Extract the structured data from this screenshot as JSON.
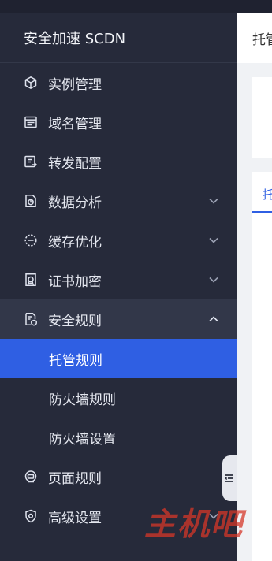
{
  "app": {
    "title": "安全加速 SCDN"
  },
  "sidebar": {
    "items": [
      {
        "label": "实例管理",
        "icon": "cube-icon"
      },
      {
        "label": "域名管理",
        "icon": "domain-window-icon"
      },
      {
        "label": "转发配置",
        "icon": "forward-config-icon"
      },
      {
        "label": "数据分析",
        "icon": "data-chart-icon",
        "expandable": true,
        "expanded": false
      },
      {
        "label": "缓存优化",
        "icon": "cache-icon",
        "expandable": true,
        "expanded": false
      },
      {
        "label": "证书加密",
        "icon": "certificate-icon",
        "expandable": true,
        "expanded": false
      },
      {
        "label": "安全规则",
        "icon": "security-doc-icon",
        "expandable": true,
        "expanded": true,
        "children": [
          {
            "label": "托管规则",
            "active": true
          },
          {
            "label": "防火墙规则"
          },
          {
            "label": "防火墙设置"
          }
        ]
      },
      {
        "label": "页面规则",
        "icon": "page-rule-icon"
      },
      {
        "label": "高级设置",
        "icon": "shield-settings-icon",
        "expandable": true,
        "expanded": false
      }
    ]
  },
  "content": {
    "header_title": "托管",
    "tab_label": "托"
  },
  "watermark": "主机吧",
  "colors": {
    "sidebar_bg": "#262a3a",
    "active_bg": "#2f5fe3",
    "open_group_bg": "#323749",
    "page_bg": "#f0f2f5"
  }
}
